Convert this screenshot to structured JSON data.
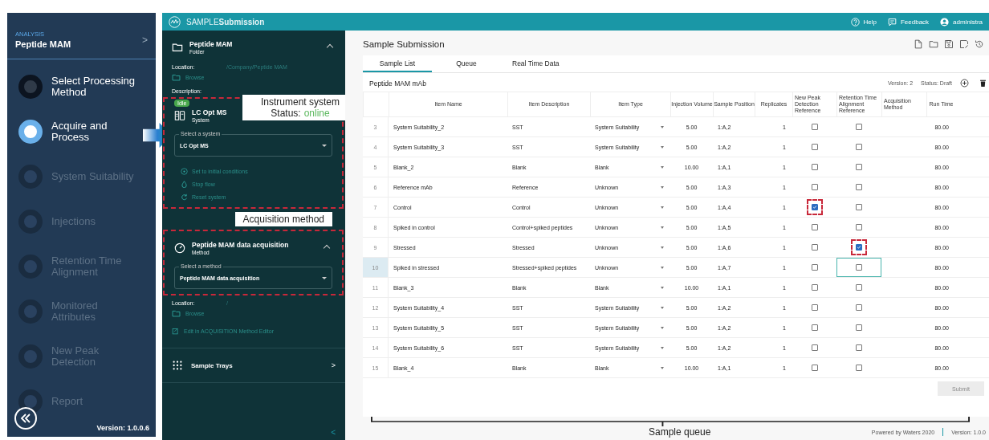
{
  "nav": {
    "section_label": "ANALYSIS",
    "title": "Peptide MAM",
    "chevron": ">",
    "version": "Version: 1.0.0.6",
    "steps": [
      {
        "label": "Select Processing Method",
        "completed": true,
        "selected": false
      },
      {
        "label": "Acquire and Process",
        "completed": false,
        "selected": true
      },
      {
        "label": "System Suitability",
        "completed": false,
        "selected": false
      },
      {
        "label": "Injections",
        "completed": false,
        "selected": false
      },
      {
        "label": "Retention Time Alignment",
        "completed": false,
        "selected": false
      },
      {
        "label": "Monitored Attributes",
        "completed": false,
        "selected": false
      },
      {
        "label": "New Peak Detection",
        "completed": false,
        "selected": false
      },
      {
        "label": "Report",
        "completed": false,
        "selected": false
      }
    ]
  },
  "header": {
    "logo": "SAMPLE**Submission**",
    "links": [
      {
        "label": "Help",
        "kind": "help"
      },
      {
        "label": "Feedback",
        "kind": "feedback"
      },
      {
        "label": "administra",
        "kind": "user"
      }
    ]
  },
  "folder": {
    "title": "Peptide MAM",
    "subtitle": "Folder",
    "expanded": true,
    "location_label": "Location:",
    "location": "/Company/Peptide MAM",
    "browse": "Browse",
    "description_label": "Description:"
  },
  "system": {
    "status": "Idle",
    "title": "LC Opt MS",
    "subtitle": "System",
    "select_label": "Select a system",
    "select_value": "LC Opt MS",
    "actions": [
      {
        "label": "Set to initial conditions",
        "kind": "target"
      },
      {
        "label": "Stop flow",
        "kind": "drop"
      },
      {
        "label": "Reset system",
        "kind": "reset"
      }
    ]
  },
  "method": {
    "title": "Peptide MAM data acquisition",
    "subtitle": "Method",
    "expanded": true,
    "select_label": "Select a method",
    "select_value": "Peptide MAM data acquisition",
    "location_label": "Location:",
    "location": "/",
    "browse": "Browse",
    "edit": "Edit in ACQUISITION Method Editor"
  },
  "trays": {
    "label": "Sample Trays",
    "chevron": ">"
  },
  "collapse": "<",
  "main": {
    "title": "Sample Submission",
    "tabs": [
      {
        "label": "Sample List",
        "selected": true
      },
      {
        "label": "Queue",
        "selected": false
      },
      {
        "label": "Real Time Data",
        "selected": false
      }
    ],
    "list_title": "Peptide MAM mAb",
    "version": "Version: 2",
    "status": "Status: Draft"
  },
  "table": {
    "columns": [
      "Item Name",
      "Item Description",
      "Item Type",
      "Injection Volume",
      "Sample Position",
      "Replicates",
      "New Peak Detection Reference",
      "Retention Time Alignment Reference",
      "Acquisition Method",
      "Run Time"
    ],
    "rows": [
      {
        "index": "3",
        "name": "System Suitability_2",
        "description": "SST",
        "type": "System Suitability",
        "volume": "5.00",
        "position": "1:A,2",
        "replicates": "1",
        "new_peak_ref": false,
        "rt_ref": false,
        "run_time": "80.00",
        "selected": false
      },
      {
        "index": "4",
        "name": "System Suitability_3",
        "description": "SST",
        "type": "System Suitability",
        "volume": "5.00",
        "position": "1:A,2",
        "replicates": "1",
        "new_peak_ref": false,
        "rt_ref": false,
        "run_time": "80.00",
        "selected": false
      },
      {
        "index": "5",
        "name": "Blank_2",
        "description": "Blank",
        "type": "Blank",
        "volume": "10.00",
        "position": "1:A,1",
        "replicates": "1",
        "new_peak_ref": false,
        "rt_ref": false,
        "run_time": "80.00",
        "selected": false
      },
      {
        "index": "6",
        "name": "Reference mAb",
        "description": "Reference",
        "type": "Unknown",
        "volume": "5.00",
        "position": "1:A,3",
        "replicates": "1",
        "new_peak_ref": false,
        "rt_ref": false,
        "run_time": "80.00",
        "selected": false
      },
      {
        "index": "7",
        "name": "Control",
        "description": "Control",
        "type": "Unknown",
        "volume": "5.00",
        "position": "1:A,4",
        "replicates": "1",
        "new_peak_ref": true,
        "rt_ref": false,
        "run_time": "80.00",
        "selected": false
      },
      {
        "index": "8",
        "name": "Spiked in control",
        "description": "Control+spiked peptides",
        "type": "Unknown",
        "volume": "5.00",
        "position": "1:A,5",
        "replicates": "1",
        "new_peak_ref": false,
        "rt_ref": false,
        "run_time": "80.00",
        "selected": false
      },
      {
        "index": "9",
        "name": "Stressed",
        "description": "Stressed",
        "type": "Unknown",
        "volume": "5.00",
        "position": "1:A,6",
        "replicates": "1",
        "new_peak_ref": false,
        "rt_ref": true,
        "run_time": "80.00",
        "selected": false
      },
      {
        "index": "10",
        "name": "Spiked in stressed",
        "description": "Stressed+spiked peptides",
        "type": "Unknown",
        "volume": "5.00",
        "position": "1:A,7",
        "replicates": "1",
        "new_peak_ref": false,
        "rt_ref": false,
        "run_time": "80.00",
        "selected": true
      },
      {
        "index": "11",
        "name": "Blank_3",
        "description": "Blank",
        "type": "Blank",
        "volume": "10.00",
        "position": "1:A,1",
        "replicates": "1",
        "new_peak_ref": false,
        "rt_ref": false,
        "run_time": "80.00",
        "selected": false
      },
      {
        "index": "12",
        "name": "System Suitability_4",
        "description": "SST",
        "type": "System Suitability",
        "volume": "5.00",
        "position": "1:A,2",
        "replicates": "1",
        "new_peak_ref": false,
        "rt_ref": false,
        "run_time": "80.00",
        "selected": false
      },
      {
        "index": "13",
        "name": "System Suitability_5",
        "description": "SST",
        "type": "System Suitability",
        "volume": "5.00",
        "position": "1:A,2",
        "replicates": "1",
        "new_peak_ref": false,
        "rt_ref": false,
        "run_time": "80.00",
        "selected": false
      },
      {
        "index": "14",
        "name": "System Suitability_6",
        "description": "SST",
        "type": "System Suitability",
        "volume": "5.00",
        "position": "1:A,2",
        "replicates": "1",
        "new_peak_ref": false,
        "rt_ref": false,
        "run_time": "80.00",
        "selected": false
      },
      {
        "index": "15",
        "name": "Blank_4",
        "description": "Blank",
        "type": "Blank",
        "volume": "10.00",
        "position": "1:A,1",
        "replicates": "1",
        "new_peak_ref": false,
        "rt_ref": false,
        "run_time": "80.00",
        "selected": false
      }
    ]
  },
  "submit": {
    "label": "Submit",
    "disabled": true
  },
  "footer": {
    "powered": "Powered by Waters 2020",
    "version": "Version: 1.0.0"
  },
  "annotations": {
    "system_title": "Instrument system",
    "status_label": "Status:",
    "status_value": "online",
    "method_title": "Acquisition method",
    "queue_label": "Sample queue"
  }
}
